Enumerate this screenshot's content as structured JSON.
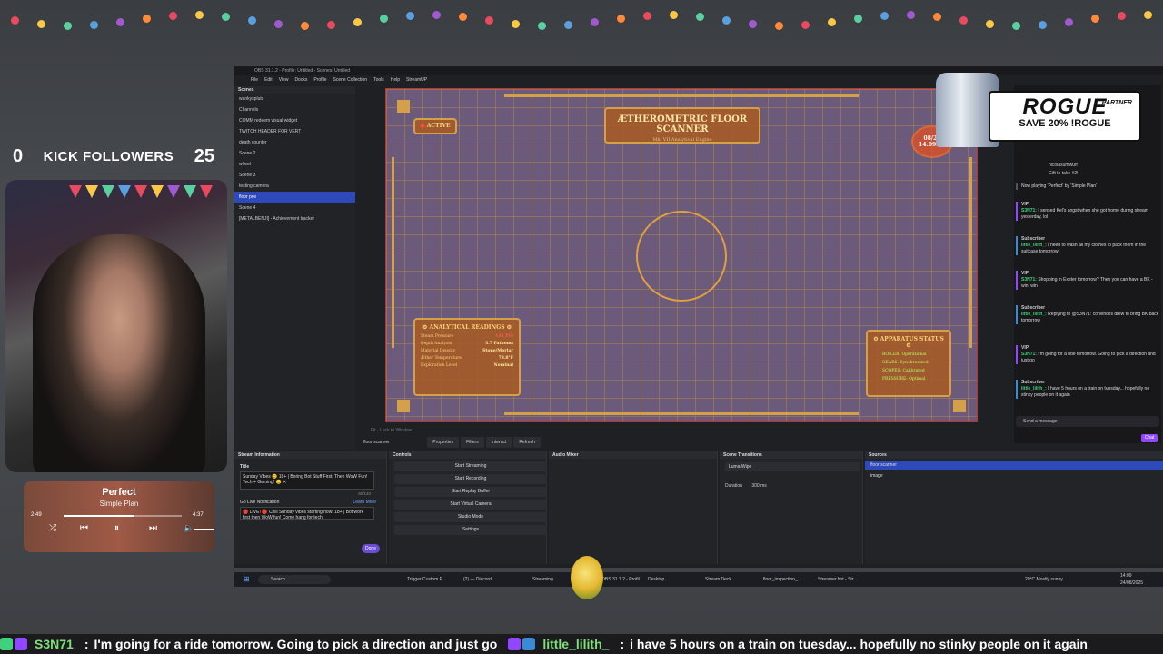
{
  "kick": {
    "left_count": "0",
    "label": "KICK FOLLOWERS",
    "right_count": "25"
  },
  "music": {
    "title": "Perfect",
    "artist": "Simple Plan",
    "elapsed": "2:49",
    "duration": "4:37",
    "progress": 0.6
  },
  "obs": {
    "window_title": "OBS 31.1.2 - Profile: Untitled - Scenes: Untitled",
    "menu": [
      "File",
      "Edit",
      "View",
      "Docks",
      "Profile",
      "Scene Collection",
      "Tools",
      "Help",
      "StreamUP"
    ],
    "scenes_header": "Scenes",
    "scenes": [
      "wankyspluts",
      "Channels",
      "COMM redeem visual widget",
      "TWITCH HEADER FOR VERT",
      "death counter",
      "Scene 2",
      "wheel",
      "Scene 3",
      "testing camera",
      "floor pov",
      "Scene 4",
      "[METALBENJI] - Achievement tracker"
    ],
    "selected_scene": "floor pov",
    "preview_bar": "Fit · Lock to Window",
    "source_selected": "floor scanner",
    "toolbar_buttons": [
      "Properties",
      "Filters",
      "Interact",
      "Refresh"
    ],
    "stream_info": {
      "header": "Stream Information",
      "title_label": "Title",
      "title_value": "Sunday Vibes 😊 18+ | Boring Bot Stuff First, Then WoW Fun! Tech + Gaming! 😊 ✕",
      "title_count": "80/140",
      "go_live_label": "Go Live Notification",
      "learn_more": "Learn More",
      "go_live_value": "🔴 LIVE! 🔴 Chill Sunday vibes starting now! 18+ | Bot work first then WoW fun! Come hang for tech!",
      "done": "Done"
    },
    "controls": {
      "header": "Controls",
      "buttons": [
        "Start Streaming",
        "Start Recording",
        "Start Replay Buffer",
        "Start Virtual Camera",
        "Studio Mode",
        "Settings"
      ]
    },
    "audio_header": "Audio Mixer",
    "transitions": {
      "header": "Scene Transitions",
      "selected": "Luma Wipe",
      "duration_label": "Duration",
      "duration_value": "300 ms"
    },
    "sources": {
      "header": "Sources",
      "items": [
        "floor scanner",
        "image"
      ]
    }
  },
  "scanner": {
    "title": "ÆTHEROMETRIC FLOOR SCANNER",
    "subtitle": "Mk. VII Analytical Engine",
    "active": "ACTIVE",
    "date": "08/24",
    "time": "14:09:33",
    "readings_header": "⚙ ANALYTICAL READINGS ⚙",
    "readings": [
      {
        "label": "Steam Pressure",
        "value": "145 PSI",
        "alert": true
      },
      {
        "label": "Depth Analysis",
        "value": "3.7 Fathoms",
        "alert": false
      },
      {
        "label": "Material Density",
        "value": "Stone/Mortar",
        "alert": false
      },
      {
        "label": "Æther Temperature",
        "value": "73.8°F",
        "alert": false
      },
      {
        "label": "Exploration Level",
        "value": "Nominal",
        "alert": false
      }
    ],
    "status_header": "⚙ APPARATUS STATUS ⚙",
    "status": [
      "BOILER: Operational",
      "GEARS: Synchronized",
      "SCOPES: Calibrated",
      "PRESSURE: Optimal"
    ]
  },
  "ad": {
    "brand": "ROGUE",
    "partner": "PARTNER",
    "promo": "SAVE 20% !ROGUE"
  },
  "chat": {
    "gift_user": "nicolasurffwuff",
    "gift_text": "Gift to take #2!",
    "now_playing": "Now playing 'Perfect' by 'Simple Plan'",
    "messages": [
      {
        "tag": "VIP",
        "user": "S3N71:",
        "text": "I sensed Kel's angst when she got home during stream yesterday, lol"
      },
      {
        "tag": "Subscriber",
        "user": "little_lilith_:",
        "text": "I need to wash all my clothes to pack them in the suitcase tomorrow"
      },
      {
        "tag": "VIP",
        "user": "S3N71:",
        "text": "Shopping in Exeter tomorrow? Then you can have a BK - win, win"
      },
      {
        "tag": "Subscriber",
        "user": "little_lilith_:",
        "text": "Replying to @S3N71: convinces drew to bring BK back tomorrow"
      },
      {
        "tag": "VIP",
        "user": "S3N71:",
        "text": "I'm going for a ride tomorrow. Going to pick a direction and just go"
      },
      {
        "tag": "Subscriber",
        "user": "little_lilith_:",
        "text": "I have 5 hours on a train on tuesday... hopefully no stinky people on it again"
      }
    ],
    "input_placeholder": "Send a message",
    "chat_button": "Chat"
  },
  "taskbar": {
    "search": "Search",
    "apps": [
      "Trigger Custom E...",
      "(2) — Discord",
      "Streaming",
      "OBS 31.1.2 - Profil...",
      "Desktop",
      "Stream Deck",
      "floor_inspection_...",
      "Streamer.bot - Str..."
    ],
    "weather": "20°C Mostly sunny",
    "time": "14:09",
    "date": "24/08/2025"
  },
  "ticker": {
    "messages": [
      {
        "user": "S3N71",
        "text": "I'm going for a ride tomorrow. Going to pick a direction and just go"
      },
      {
        "user": "little_lilith_",
        "text": "i have 5 hours on a train on tuesday... hopefully no stinky people on it again"
      }
    ]
  },
  "colors": {
    "obs_bg": "#1f2024",
    "obs_select": "#2e49b9",
    "twitch_purple": "#9147ff",
    "scanner_gold": "#d4a04a",
    "chat_green": "#3fd17b"
  }
}
